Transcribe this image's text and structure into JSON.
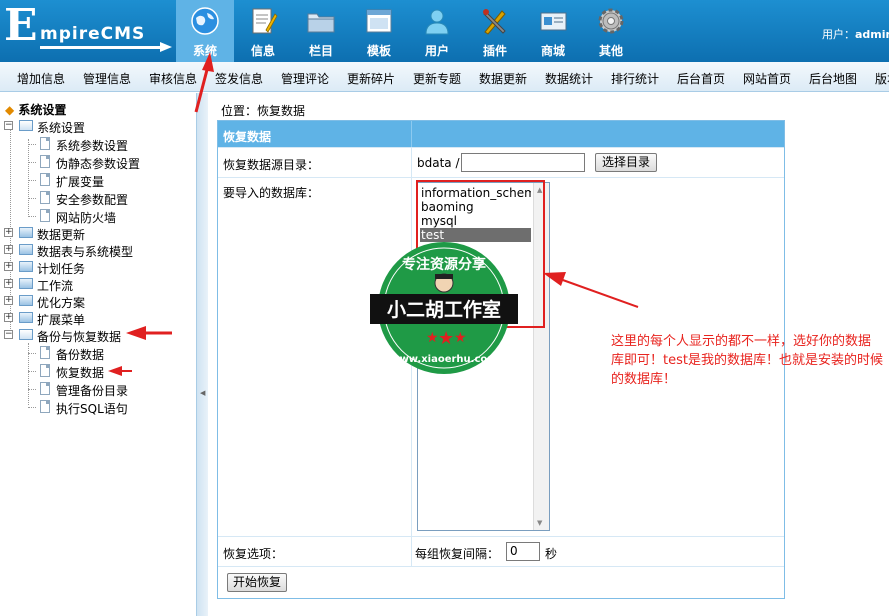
{
  "header": {
    "logo_letter": "E",
    "logo_rest": "mpireCMS",
    "nav": [
      {
        "label": "系统",
        "icon": "globe-icon",
        "active": true
      },
      {
        "label": "信息",
        "icon": "document-icon",
        "active": false
      },
      {
        "label": "栏目",
        "icon": "folder-icon",
        "active": false
      },
      {
        "label": "模板",
        "icon": "window-icon",
        "active": false
      },
      {
        "label": "用户",
        "icon": "user-icon",
        "active": false
      },
      {
        "label": "插件",
        "icon": "tools-icon",
        "active": false
      },
      {
        "label": "商城",
        "icon": "card-icon",
        "active": false
      },
      {
        "label": "其他",
        "icon": "gear-icon",
        "active": false
      }
    ],
    "user_label": "用户：",
    "user_name": "admin"
  },
  "menubar": [
    "增加信息",
    "管理信息",
    "审核信息",
    "签发信息",
    "管理评论",
    "更新碎片",
    "更新专题",
    "数据更新",
    "数据统计",
    "排行统计",
    "后台首页",
    "网站首页",
    "后台地图",
    "版本"
  ],
  "sidebar": {
    "title": "系统设置",
    "groups": [
      {
        "label": "系统设置",
        "expanded": true,
        "children": [
          "系统参数设置",
          "伪静态参数设置",
          "扩展变量",
          "安全参数配置",
          "网站防火墙"
        ]
      },
      {
        "label": "数据更新",
        "expanded": false
      },
      {
        "label": "数据表与系统模型",
        "expanded": false
      },
      {
        "label": "计划任务",
        "expanded": false
      },
      {
        "label": "工作流",
        "expanded": false
      },
      {
        "label": "优化方案",
        "expanded": false
      },
      {
        "label": "扩展菜单",
        "expanded": false
      },
      {
        "label": "备份与恢复数据",
        "expanded": true,
        "children": [
          "备份数据",
          "恢复数据",
          "管理备份目录",
          "执行SQL语句"
        ]
      }
    ]
  },
  "main": {
    "breadcrumb": "位置：恢复数据",
    "table_title": "恢复数据",
    "source_dir_label": "恢复数据源目录：",
    "source_dir_prefix": "bdata /",
    "source_dir_value": "",
    "choose_dir_button": "选择目录",
    "database_label": "要导入的数据库：",
    "databases": [
      "information_schema",
      "baoming",
      "mysql",
      "test"
    ],
    "selected_database": "test",
    "restore_options_label": "恢复选项：",
    "interval_label": "每组恢复间隔：",
    "interval_value": "0",
    "interval_unit": "秒",
    "start_button": "开始恢复"
  },
  "annotation": {
    "note": "这里的每个人显示的都不一样，选好你的数据库即可！test是我的数据库！也就是安装的时候的数据库！",
    "color": "#e8231e"
  },
  "watermark": {
    "top_text": "专注资源分享",
    "banner": "小二胡工作室",
    "url": "www.xiaoerhu.com"
  },
  "colors": {
    "header_blue": "#0d6fb0",
    "accent_blue": "#5fb3e6",
    "annotation_red": "#e8231e"
  }
}
